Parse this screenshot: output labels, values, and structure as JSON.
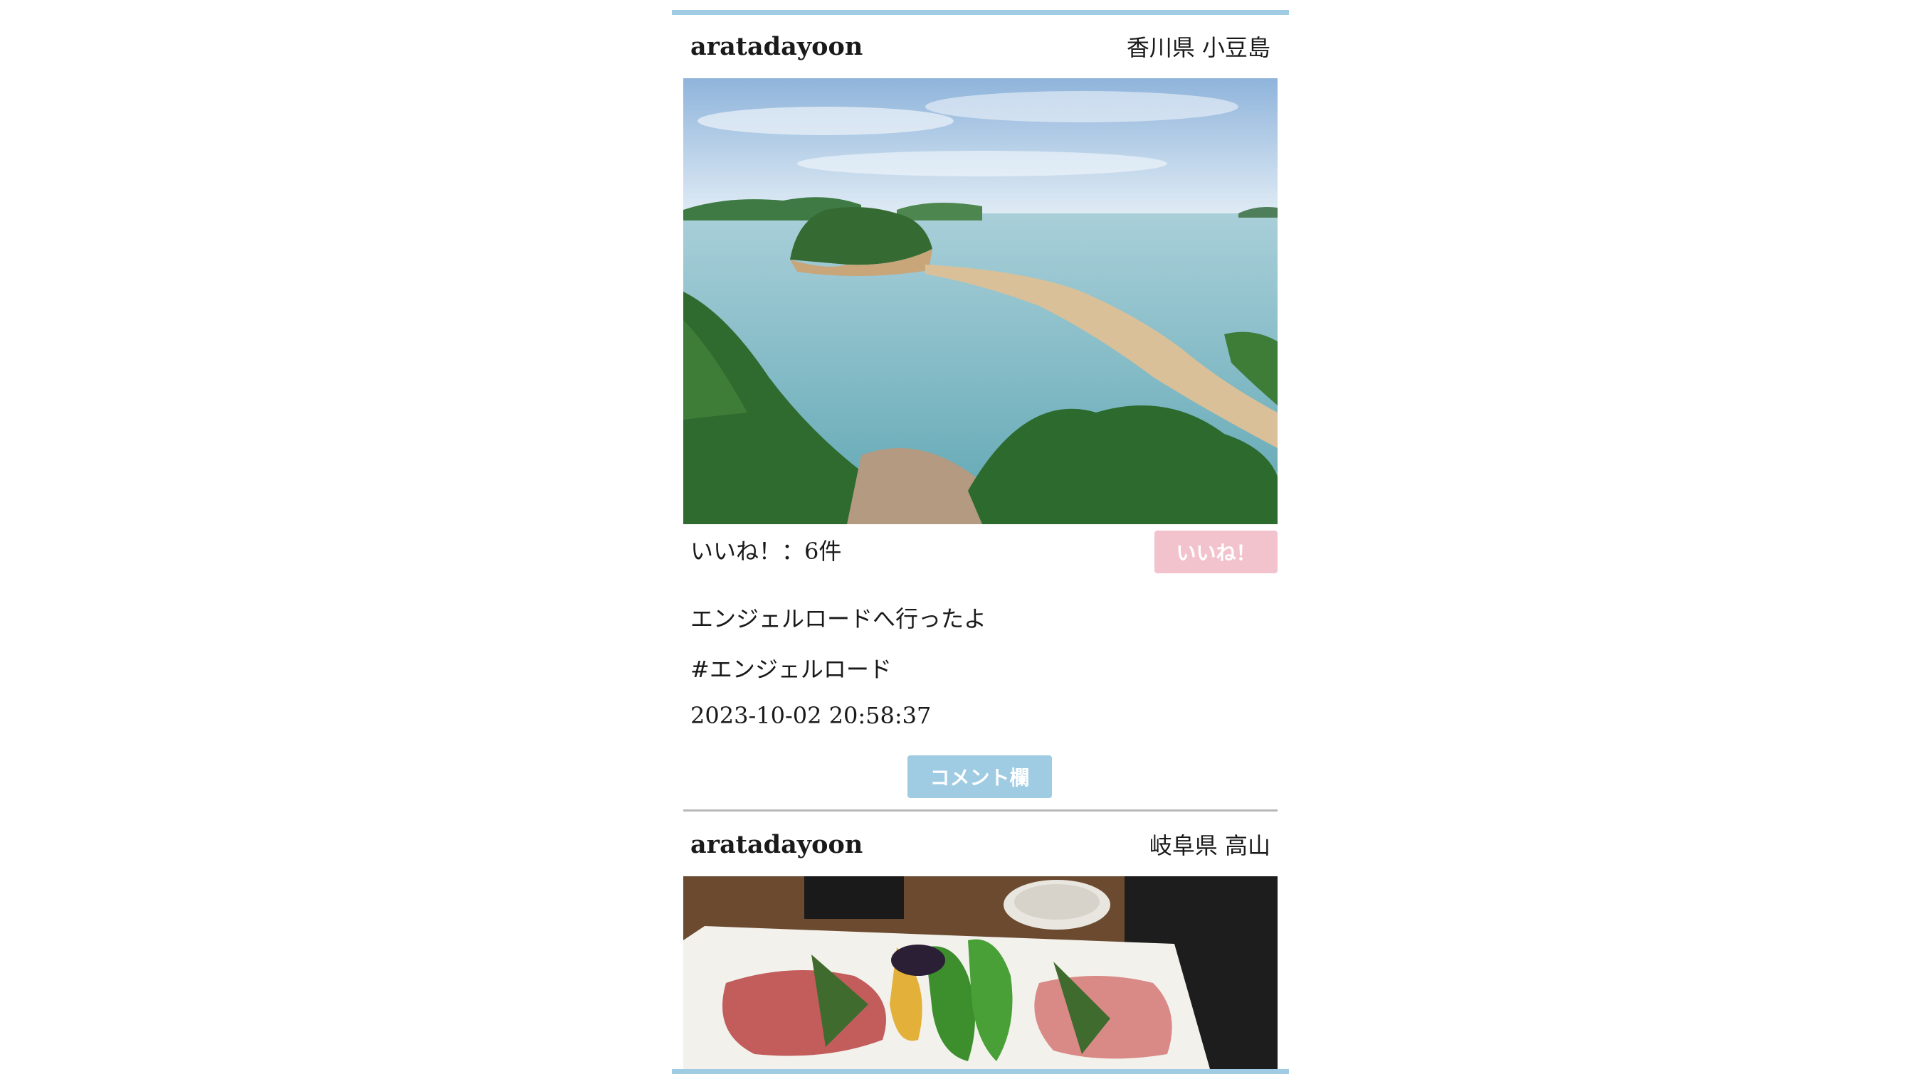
{
  "posts": [
    {
      "username": "aratadayoon",
      "location": "香川県 小豆島",
      "photo_subject": "island-sandbar-photo",
      "likes_text": "いいね！：6件",
      "like_button_label": "いいね！",
      "caption": "エンジェルロードへ行ったよ",
      "hashtag": "#エンジェルロード",
      "timestamp": "2023-10-02 20:58:37",
      "comment_button_label": "コメント欄"
    },
    {
      "username": "aratadayoon",
      "location": "岐阜県 高山",
      "photo_subject": "yakiniku-platter-photo"
    }
  ],
  "colors": {
    "accent_blue": "#9fcbe3",
    "like_pink": "#f3c3cd",
    "divider": "#b8b8b8"
  }
}
